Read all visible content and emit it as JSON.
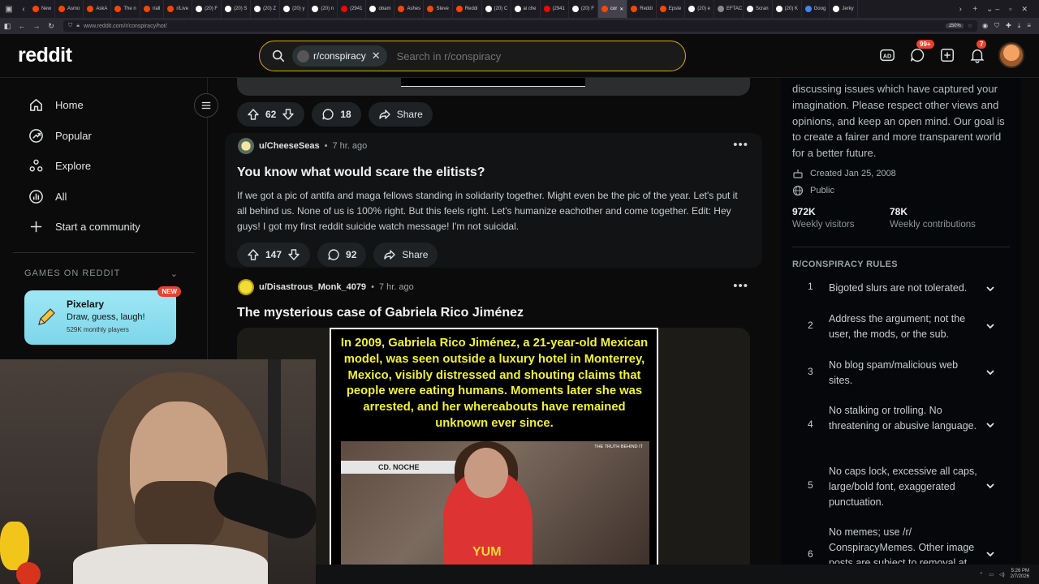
{
  "browser": {
    "tabs": [
      {
        "label": "New",
        "color": "#ff4500"
      },
      {
        "label": "Asmo",
        "color": "#ff4500"
      },
      {
        "label": "AskA",
        "color": "#ff4500"
      },
      {
        "label": "The n",
        "color": "#ff4500"
      },
      {
        "label": "r/all",
        "color": "#ff4500"
      },
      {
        "label": "r/Live",
        "color": "#ff4500"
      },
      {
        "label": "(20) F",
        "color": "#ffffff"
      },
      {
        "label": "(20) S",
        "color": "#ffffff"
      },
      {
        "label": "(20) Z",
        "color": "#ffffff"
      },
      {
        "label": "(20) y",
        "color": "#ffffff"
      },
      {
        "label": "(20) n",
        "color": "#ffffff"
      },
      {
        "label": "(2941",
        "color": "#ff0000"
      },
      {
        "label": "obam",
        "color": "#ffffff"
      },
      {
        "label": "Ashes",
        "color": "#ff4500"
      },
      {
        "label": "Steve",
        "color": "#ff4500"
      },
      {
        "label": "Reddi",
        "color": "#ff4500"
      },
      {
        "label": "(20) C",
        "color": "#ffffff"
      },
      {
        "label": "ai che",
        "color": "#ffffff"
      },
      {
        "label": "(2941",
        "color": "#ff0000"
      },
      {
        "label": "(20) F",
        "color": "#ffffff"
      },
      {
        "label": "cor",
        "color": "#ff4500",
        "active": true
      },
      {
        "label": "Reddi",
        "color": "#ff4500"
      },
      {
        "label": "Epste",
        "color": "#ff4500"
      },
      {
        "label": "(20) e",
        "color": "#ffffff"
      },
      {
        "label": "EFTAC",
        "color": "#888888"
      },
      {
        "label": "Scran",
        "color": "#ffffff"
      },
      {
        "label": "(20) K",
        "color": "#ffffff"
      },
      {
        "label": "Goog",
        "color": "#4285f4"
      },
      {
        "label": "Jerky",
        "color": "#ffffff"
      }
    ],
    "url": "www.reddit.com/r/conspiracy/hot/",
    "zoom": "150%"
  },
  "header": {
    "logo": "reddit",
    "search_chip": "r/conspiracy",
    "search_placeholder": "Search in r/conspiracy",
    "chat_badge": "99+",
    "notif_badge": "7"
  },
  "leftnav": {
    "items": [
      {
        "label": "Home",
        "icon": "home-icon"
      },
      {
        "label": "Popular",
        "icon": "popular-icon"
      },
      {
        "label": "Explore",
        "icon": "explore-icon"
      },
      {
        "label": "All",
        "icon": "all-icon"
      },
      {
        "label": "Start a community",
        "icon": "plus-icon"
      }
    ],
    "games_heading": "GAMES ON REDDIT",
    "game": {
      "title": "Pixelary",
      "desc": "Draw, guess, laugh!",
      "players": "529K monthly players",
      "tag": "NEW"
    }
  },
  "feed": {
    "prev_post": {
      "upvotes": "62",
      "comments": "18",
      "share": "Share"
    },
    "post1": {
      "user": "u/CheeseSeas",
      "time": "7 hr. ago",
      "title": "You know what would scare the elitists?",
      "body": "If we got a pic of antifa and maga fellows standing in solidarity together. Might even be the pic of the year. Let's put it all behind us. None of us is 100% right. But this feels right. Let's humanize eachother and come together. Edit: Hey guys! I got my first reddit suicide watch message! I'm not suicidal.",
      "upvotes": "147",
      "comments": "92",
      "share": "Share"
    },
    "post2": {
      "user": "u/Disastrous_Monk_4079",
      "time": "7 hr. ago",
      "title": "The mysterious case of Gabriela Rico Jiménez",
      "image_caption": "In 2009, Gabriela Rico Jiménez, a 21-year-old Mexican model, was seen outside a luxury hotel in Monterrey, Mexico, visibly distressed and shouting claims that people were eating humans. Moments later she was arrested, and her whereabouts have remained unknown ever since.",
      "tv_label": "CD. NOCHE",
      "watermark": "THE TRUTH BEHIND IT",
      "shirt_text": "YUM"
    }
  },
  "rightbar": {
    "description": "discussing issues which have captured your imagination. Please respect other views and opinions, and keep an open mind. Our goal is to create a fairer and more transparent world for a better future.",
    "created": "Created Jan 25, 2008",
    "visibility": "Public",
    "weekly_visitors": "972K",
    "weekly_visitors_label": "Weekly visitors",
    "weekly_contrib": "78K",
    "weekly_contrib_label": "Weekly contributions",
    "rules_heading": "R/CONSPIRACY RULES",
    "rules": [
      {
        "n": "1",
        "text": "Bigoted slurs are not tolerated."
      },
      {
        "n": "2",
        "text": "Address the argument; not the user, the mods, or the sub."
      },
      {
        "n": "3",
        "text": "No blog spam/malicious web sites."
      },
      {
        "n": "4",
        "text": "No stalking or trolling. No threatening or abusive language."
      },
      {
        "n": "5",
        "text": "No caps lock, excessive all caps, large/bold font, exaggerated punctuation."
      },
      {
        "n": "6",
        "text": "No memes; use /r/ ConspiracyMemes. Other image posts are subject to removal at"
      }
    ]
  },
  "taskbar": {
    "time": "5:26 PM",
    "date": "2/7/2026"
  }
}
